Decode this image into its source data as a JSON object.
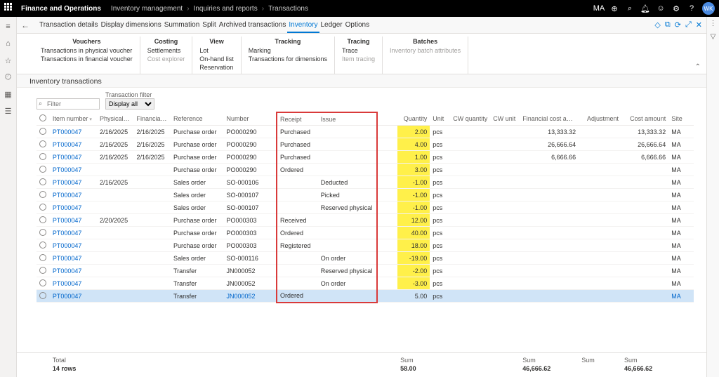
{
  "topbar": {
    "brand": "Finance and Operations",
    "crumbs": [
      "Inventory management",
      "Inquiries and reports",
      "Transactions"
    ],
    "user_initials_right": "WK",
    "user_initials_left": "MA"
  },
  "tabs": {
    "items": [
      "Transaction details",
      "Display dimensions",
      "Summation",
      "Split",
      "Archived transactions",
      "Inventory",
      "Ledger",
      "Options"
    ],
    "active_index": 5
  },
  "ribbon": {
    "groups": [
      {
        "head": "Vouchers",
        "items": [
          "Transactions in physical voucher",
          "Transactions in financial voucher"
        ]
      },
      {
        "head": "Costing",
        "items": [
          "Settlements",
          "Cost explorer"
        ],
        "disabled": [
          1
        ]
      },
      {
        "head": "View",
        "items": [
          "Lot",
          "On-hand list",
          "Reservation"
        ]
      },
      {
        "head": "Tracking",
        "items": [
          "Marking",
          "Transactions for dimensions"
        ]
      },
      {
        "head": "Tracing",
        "items": [
          "Trace",
          "Item tracing"
        ],
        "disabled": [
          1
        ]
      },
      {
        "head": "Batches",
        "items": [
          "Inventory batch attributes"
        ],
        "disabled": [
          0
        ]
      }
    ]
  },
  "page_title": "Inventory transactions",
  "filter": {
    "placeholder": "Filter",
    "label": "Transaction filter",
    "value": "Display all"
  },
  "columns": [
    "",
    "Item number",
    "Physical date",
    "Financial date",
    "Reference",
    "Number",
    "Receipt",
    "Issue",
    "",
    "Quantity",
    "Unit",
    "CW quantity",
    "CW unit",
    "Financial cost amount",
    "Adjustment",
    "Cost amount",
    "Site",
    ""
  ],
  "rows": [
    {
      "item": "PT000047",
      "pdate": "2/16/2025",
      "fdate": "2/16/2025",
      "ref": "Purchase order",
      "num": "PO000290",
      "receipt": "Purchased",
      "issue": "",
      "qty": "2.00",
      "unit": "pcs",
      "fca": "13,333.32",
      "camt": "13,333.32",
      "site": "MA",
      "numlink": false
    },
    {
      "item": "PT000047",
      "pdate": "2/16/2025",
      "fdate": "2/16/2025",
      "ref": "Purchase order",
      "num": "PO000290",
      "receipt": "Purchased",
      "issue": "",
      "qty": "4.00",
      "unit": "pcs",
      "fca": "26,666.64",
      "camt": "26,666.64",
      "site": "MA",
      "numlink": false
    },
    {
      "item": "PT000047",
      "pdate": "2/16/2025",
      "fdate": "2/16/2025",
      "ref": "Purchase order",
      "num": "PO000290",
      "receipt": "Purchased",
      "issue": "",
      "qty": "1.00",
      "unit": "pcs",
      "fca": "6,666.66",
      "camt": "6,666.66",
      "site": "MA",
      "numlink": false
    },
    {
      "item": "PT000047",
      "pdate": "",
      "fdate": "",
      "ref": "Purchase order",
      "num": "PO000290",
      "receipt": "Ordered",
      "issue": "",
      "qty": "3.00",
      "unit": "pcs",
      "fca": "",
      "camt": "",
      "site": "MA",
      "numlink": false
    },
    {
      "item": "PT000047",
      "pdate": "2/16/2025",
      "fdate": "",
      "ref": "Sales order",
      "num": "SO-000106",
      "receipt": "",
      "issue": "Deducted",
      "qty": "-1.00",
      "unit": "pcs",
      "fca": "",
      "camt": "",
      "site": "MA",
      "numlink": false
    },
    {
      "item": "PT000047",
      "pdate": "",
      "fdate": "",
      "ref": "Sales order",
      "num": "SO-000107",
      "receipt": "",
      "issue": "Picked",
      "qty": "-1.00",
      "unit": "pcs",
      "fca": "",
      "camt": "",
      "site": "MA",
      "numlink": false
    },
    {
      "item": "PT000047",
      "pdate": "",
      "fdate": "",
      "ref": "Sales order",
      "num": "SO-000107",
      "receipt": "",
      "issue": "Reserved physical",
      "qty": "-1.00",
      "unit": "pcs",
      "fca": "",
      "camt": "",
      "site": "MA",
      "numlink": false
    },
    {
      "item": "PT000047",
      "pdate": "2/20/2025",
      "fdate": "",
      "ref": "Purchase order",
      "num": "PO000303",
      "receipt": "Received",
      "issue": "",
      "qty": "12.00",
      "unit": "pcs",
      "fca": "",
      "camt": "",
      "site": "MA",
      "numlink": false
    },
    {
      "item": "PT000047",
      "pdate": "",
      "fdate": "",
      "ref": "Purchase order",
      "num": "PO000303",
      "receipt": "Ordered",
      "issue": "",
      "qty": "40.00",
      "unit": "pcs",
      "fca": "",
      "camt": "",
      "site": "MA",
      "numlink": false
    },
    {
      "item": "PT000047",
      "pdate": "",
      "fdate": "",
      "ref": "Purchase order",
      "num": "PO000303",
      "receipt": "Registered",
      "issue": "",
      "qty": "18.00",
      "unit": "pcs",
      "fca": "",
      "camt": "",
      "site": "MA",
      "numlink": false
    },
    {
      "item": "PT000047",
      "pdate": "",
      "fdate": "",
      "ref": "Sales order",
      "num": "SO-000116",
      "receipt": "",
      "issue": "On order",
      "qty": "-19.00",
      "unit": "pcs",
      "fca": "",
      "camt": "",
      "site": "MA",
      "numlink": false
    },
    {
      "item": "PT000047",
      "pdate": "",
      "fdate": "",
      "ref": "Transfer",
      "num": "JN000052",
      "receipt": "",
      "issue": "Reserved physical",
      "qty": "-2.00",
      "unit": "pcs",
      "fca": "",
      "camt": "",
      "site": "MA",
      "numlink": false
    },
    {
      "item": "PT000047",
      "pdate": "",
      "fdate": "",
      "ref": "Transfer",
      "num": "JN000052",
      "receipt": "",
      "issue": "On order",
      "qty": "-3.00",
      "unit": "pcs",
      "fca": "",
      "camt": "",
      "site": "MA",
      "numlink": false
    },
    {
      "item": "PT000047",
      "pdate": "",
      "fdate": "",
      "ref": "Transfer",
      "num": "JN000052",
      "receipt": "Ordered",
      "issue": "",
      "qty": "5.00",
      "unit": "pcs",
      "fca": "",
      "camt": "",
      "site": "MA",
      "numlink": true,
      "selected": true
    }
  ],
  "footer": {
    "total_label": "Total",
    "row_count": "14 rows",
    "sum_label": "Sum",
    "qty_sum": "58.00",
    "fca_sum": "46,666.62",
    "camt_sum": "46,666.62"
  }
}
